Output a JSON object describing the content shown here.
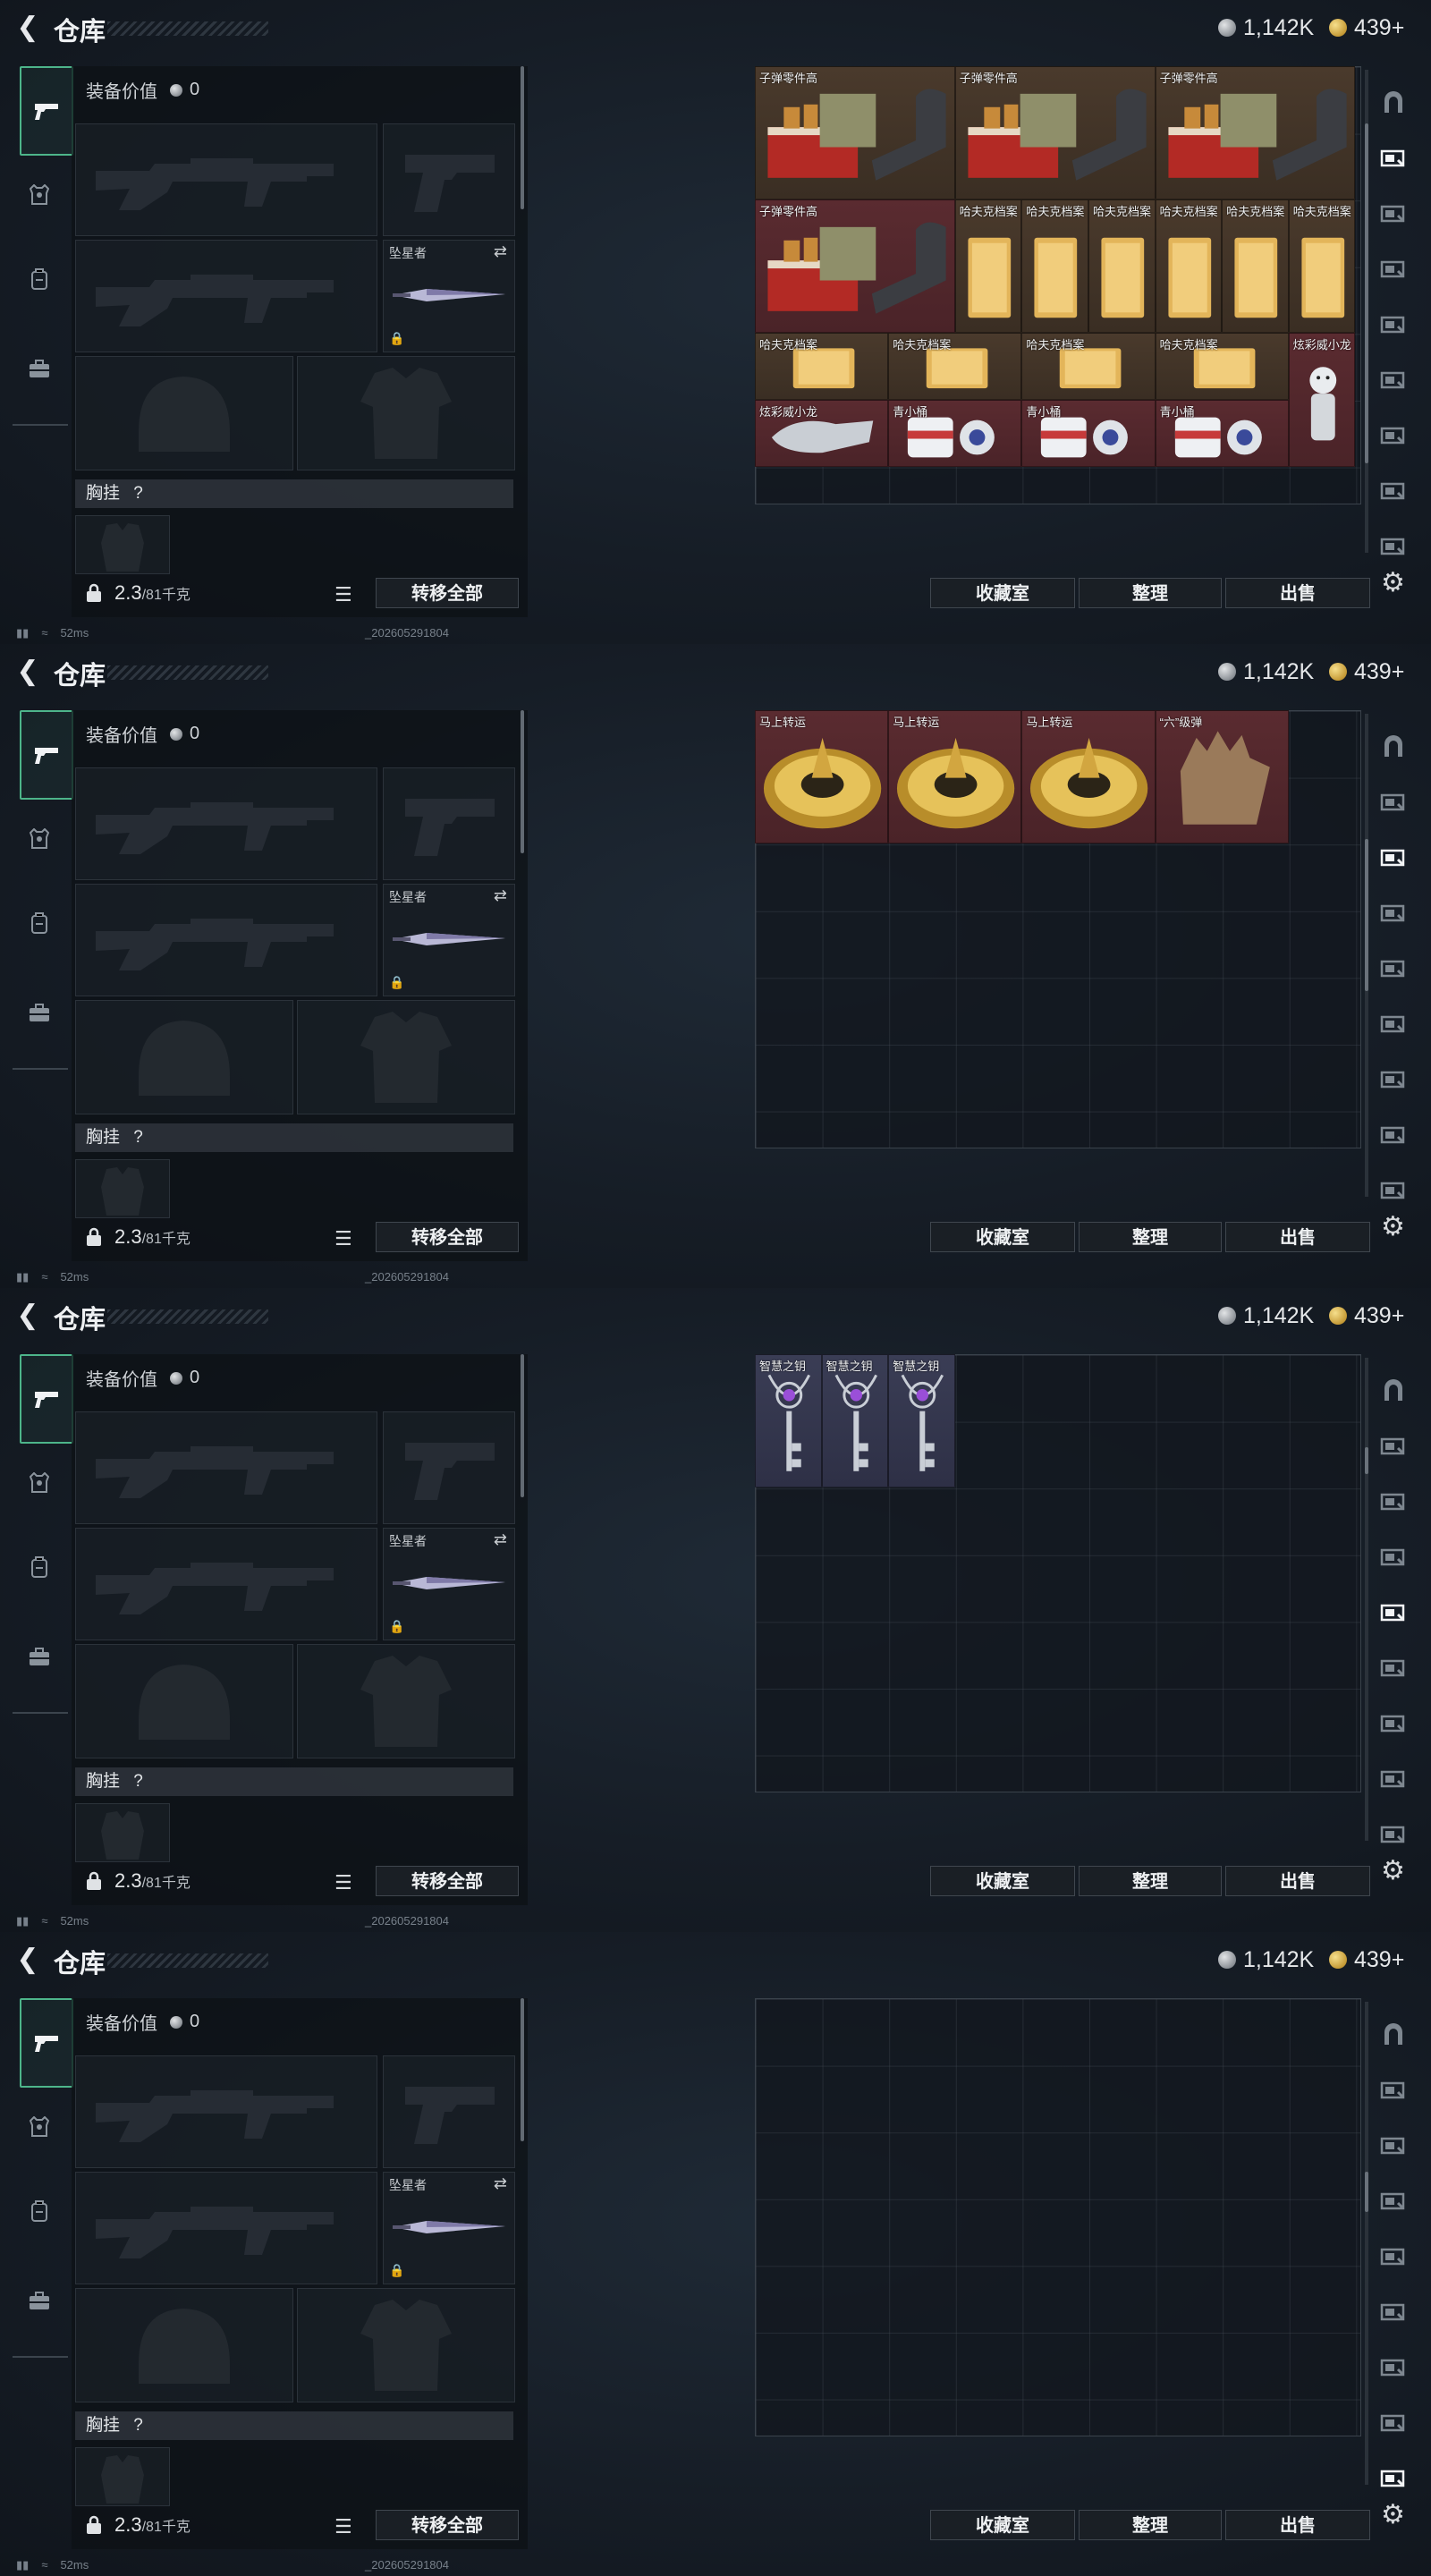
{
  "header": {
    "title": "仓库",
    "silver": "1,142K",
    "gold": "439+"
  },
  "loadout": {
    "value_label": "装备价值",
    "value": "0",
    "melee_name": "坠星者",
    "chest_label": "胸挂",
    "chest_q": "?",
    "weight": "2.3",
    "weight_max": "/81千克",
    "transfer_all": "转移全部"
  },
  "buttons": {
    "collection": "收藏室",
    "sort": "整理",
    "sell": "出售"
  },
  "status": {
    "ping": "52ms",
    "version": "_202605291804"
  },
  "pages": [
    {
      "items": [
        {
          "name": "子弹零件高",
          "col": 0,
          "row": 0,
          "w": 3,
          "h": 2,
          "color": "brown",
          "icon": "ammo-parts"
        },
        {
          "name": "子弹零件高",
          "col": 3,
          "row": 0,
          "w": 3,
          "h": 2,
          "color": "brown",
          "icon": "ammo-parts"
        },
        {
          "name": "子弹零件高",
          "col": 6,
          "row": 0,
          "w": 3,
          "h": 2,
          "color": "brown",
          "icon": "ammo-parts"
        },
        {
          "name": "子弹零件高",
          "col": 0,
          "row": 2,
          "w": 3,
          "h": 2,
          "color": "red",
          "icon": "ammo-parts"
        },
        {
          "name": "哈夫克档案",
          "col": 3,
          "row": 2,
          "w": 1,
          "h": 2,
          "color": "brown",
          "icon": "dossier"
        },
        {
          "name": "哈夫克档案",
          "col": 4,
          "row": 2,
          "w": 1,
          "h": 2,
          "color": "brown",
          "icon": "dossier"
        },
        {
          "name": "哈夫克档案",
          "col": 5,
          "row": 2,
          "w": 1,
          "h": 2,
          "color": "brown",
          "icon": "dossier"
        },
        {
          "name": "哈夫克档案",
          "col": 6,
          "row": 2,
          "w": 1,
          "h": 2,
          "color": "brown",
          "icon": "dossier"
        },
        {
          "name": "哈夫克档案",
          "col": 7,
          "row": 2,
          "w": 1,
          "h": 2,
          "color": "brown",
          "icon": "dossier"
        },
        {
          "name": "哈夫克档案",
          "col": 8,
          "row": 2,
          "w": 1,
          "h": 2,
          "color": "brown",
          "icon": "dossier"
        },
        {
          "name": "哈夫克档案",
          "col": 0,
          "row": 4,
          "w": 2,
          "h": 1,
          "color": "brown",
          "icon": "dossier-flat"
        },
        {
          "name": "哈夫克档案",
          "col": 2,
          "row": 4,
          "w": 2,
          "h": 1,
          "color": "brown",
          "icon": "dossier-flat"
        },
        {
          "name": "哈夫克档案",
          "col": 4,
          "row": 4,
          "w": 2,
          "h": 1,
          "color": "brown",
          "icon": "dossier-flat"
        },
        {
          "name": "哈夫克档案",
          "col": 6,
          "row": 4,
          "w": 2,
          "h": 1,
          "color": "brown",
          "icon": "dossier-flat"
        },
        {
          "name": "炫彩威小龙",
          "col": 8,
          "row": 4,
          "w": 1,
          "h": 2,
          "color": "red",
          "icon": "figurine"
        },
        {
          "name": "炫彩威小龙",
          "col": 0,
          "row": 5,
          "w": 2,
          "h": 1,
          "color": "red",
          "icon": "glove"
        },
        {
          "name": "青小桶",
          "col": 2,
          "row": 5,
          "w": 2,
          "h": 1,
          "color": "red",
          "icon": "canister"
        },
        {
          "name": "青小桶",
          "col": 4,
          "row": 5,
          "w": 2,
          "h": 1,
          "color": "red",
          "icon": "canister"
        },
        {
          "name": "青小桶",
          "col": 6,
          "row": 5,
          "w": 2,
          "h": 1,
          "color": "red",
          "icon": "canister"
        }
      ]
    },
    {
      "items": [
        {
          "name": "马上转运",
          "col": 0,
          "row": 0,
          "w": 2,
          "h": 2,
          "color": "red",
          "icon": "compass"
        },
        {
          "name": "马上转运",
          "col": 2,
          "row": 0,
          "w": 2,
          "h": 2,
          "color": "red",
          "icon": "compass"
        },
        {
          "name": "马上转运",
          "col": 4,
          "row": 0,
          "w": 2,
          "h": 2,
          "color": "red",
          "icon": "compass"
        },
        {
          "name": "“六”级弹",
          "col": 6,
          "row": 0,
          "w": 2,
          "h": 2,
          "color": "red",
          "icon": "hand"
        }
      ]
    },
    {
      "items": [
        {
          "name": "智慧之钥",
          "col": 0,
          "row": 0,
          "w": 1,
          "h": 2,
          "color": "purple",
          "icon": "key"
        },
        {
          "name": "智慧之钥",
          "col": 1,
          "row": 0,
          "w": 1,
          "h": 2,
          "color": "purple",
          "icon": "key"
        },
        {
          "name": "智慧之钥",
          "col": 2,
          "row": 0,
          "w": 1,
          "h": 2,
          "color": "purple",
          "icon": "key"
        }
      ]
    },
    {
      "items": []
    }
  ]
}
